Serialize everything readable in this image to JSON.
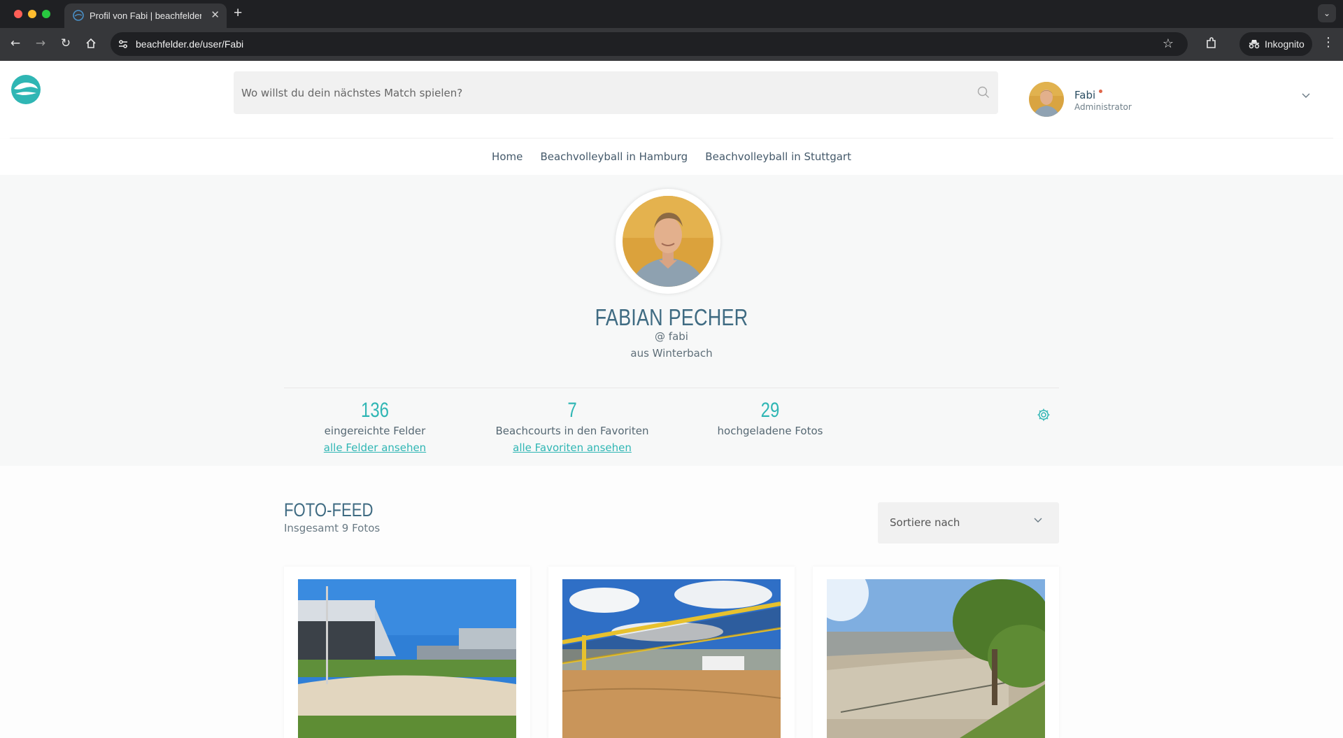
{
  "browser": {
    "tab_title": "Profil von Fabi | beachfelder.d",
    "new_tab": "+",
    "tab_close": "✕",
    "url": "beachfelder.de/user/Fabi",
    "incognito_label": "Inkognito",
    "icons": [
      "back-icon",
      "forward-icon",
      "reload-icon",
      "home-icon",
      "site-info-icon",
      "star-icon",
      "extensions-icon",
      "incognito-icon",
      "more-icon"
    ]
  },
  "header": {
    "search_placeholder": "Wo willst du dein nächstes Match spielen?",
    "user": {
      "name": "Fabi",
      "role": "Administrator"
    }
  },
  "subnav": {
    "links": [
      "Home",
      "Beachvolleyball in Hamburg",
      "Beachvolleyball in Stuttgart"
    ]
  },
  "profile": {
    "name": "FABIAN PECHER",
    "handle": "@ fabi",
    "location": "aus Winterbach",
    "stats": [
      {
        "value": "136",
        "label": "eingereichte Felder",
        "link": "alle Felder ansehen"
      },
      {
        "value": "7",
        "label": "Beachcourts in den Favoriten",
        "link": "alle Favoriten ansehen"
      },
      {
        "value": "29",
        "label": "hochgeladene Fotos",
        "link": ""
      }
    ]
  },
  "feed": {
    "title": "FOTO-FEED",
    "subtitle": "Insgesamt 9 Fotos",
    "sort_label": "Sortiere nach"
  },
  "colors": {
    "accent": "#2fb6b4",
    "heading": "#3f6b82",
    "browser_dark": "#1f2023",
    "browser_mid": "#36373a"
  }
}
